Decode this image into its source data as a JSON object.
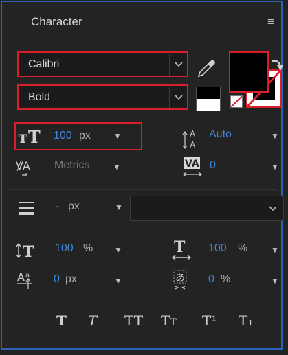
{
  "panel": {
    "title": "Character",
    "menu_glyph": "≡"
  },
  "font": {
    "family": "Calibri",
    "style": "Bold"
  },
  "colors": {
    "fill": "#000000",
    "stroke": "none",
    "highlight_border": "#d81f2a",
    "accent_value": "#3d86d8"
  },
  "size": {
    "value": "100",
    "unit": "px"
  },
  "leading": {
    "value": "Auto"
  },
  "kerning": {
    "value": "Metrics"
  },
  "tracking": {
    "value": "0"
  },
  "stroke_width": {
    "value": "-",
    "unit": "px"
  },
  "vertical_scale": {
    "value": "100",
    "unit": "%"
  },
  "horizontal_scale": {
    "value": "100",
    "unit": "%"
  },
  "baseline_shift": {
    "value": "0",
    "unit": "px"
  },
  "tsume": {
    "value": "0",
    "unit": "%"
  },
  "style_buttons": [
    {
      "label": "T",
      "name": "faux-bold"
    },
    {
      "label": "T",
      "name": "faux-italic"
    },
    {
      "label": "TT",
      "name": "all-caps"
    },
    {
      "label": "Tt",
      "name": "small-caps"
    },
    {
      "label": "T¹",
      "name": "superscript"
    },
    {
      "label": "T₁",
      "name": "subscript"
    }
  ]
}
